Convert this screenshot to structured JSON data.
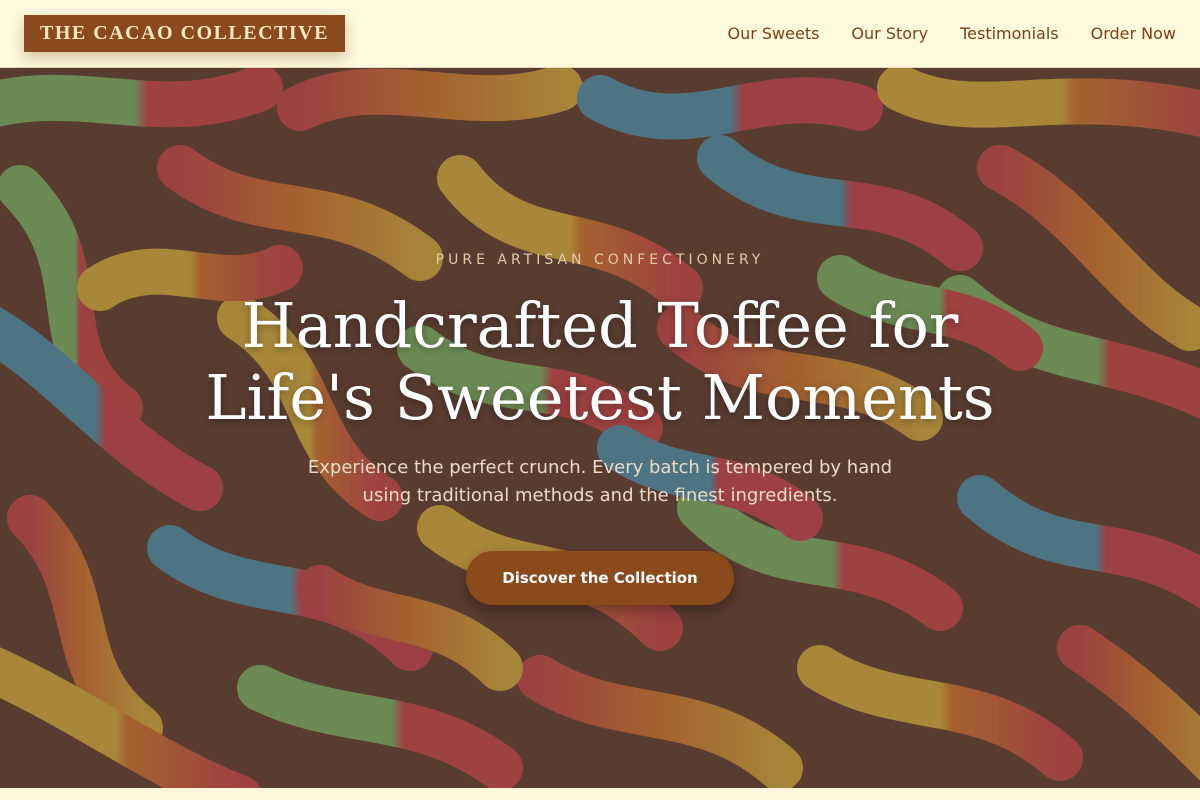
{
  "brand": {
    "logo_text": "THE CACAO COLLECTIVE"
  },
  "nav": {
    "items": [
      {
        "label": "Our Sweets"
      },
      {
        "label": "Our Story"
      },
      {
        "label": "Testimonials"
      },
      {
        "label": "Order Now"
      }
    ]
  },
  "hero": {
    "eyebrow": "PURE ARTISAN CONFECTIONERY",
    "headline_line1": "Handcrafted Toffee for",
    "headline_line2": "Life's Sweetest Moments",
    "subtext_line1": "Experience the perfect crunch. Every batch is tempered by hand",
    "subtext_line2": "using traditional methods and the finest ingredients.",
    "cta_label": "Discover the Collection",
    "background_image": "sour-gummy-worms-photo"
  },
  "colors": {
    "accent": "#8b4a1c",
    "nav_bg": "#fef8dc",
    "nav_text": "#7a4214",
    "eyebrow": "#e3c9a8"
  }
}
